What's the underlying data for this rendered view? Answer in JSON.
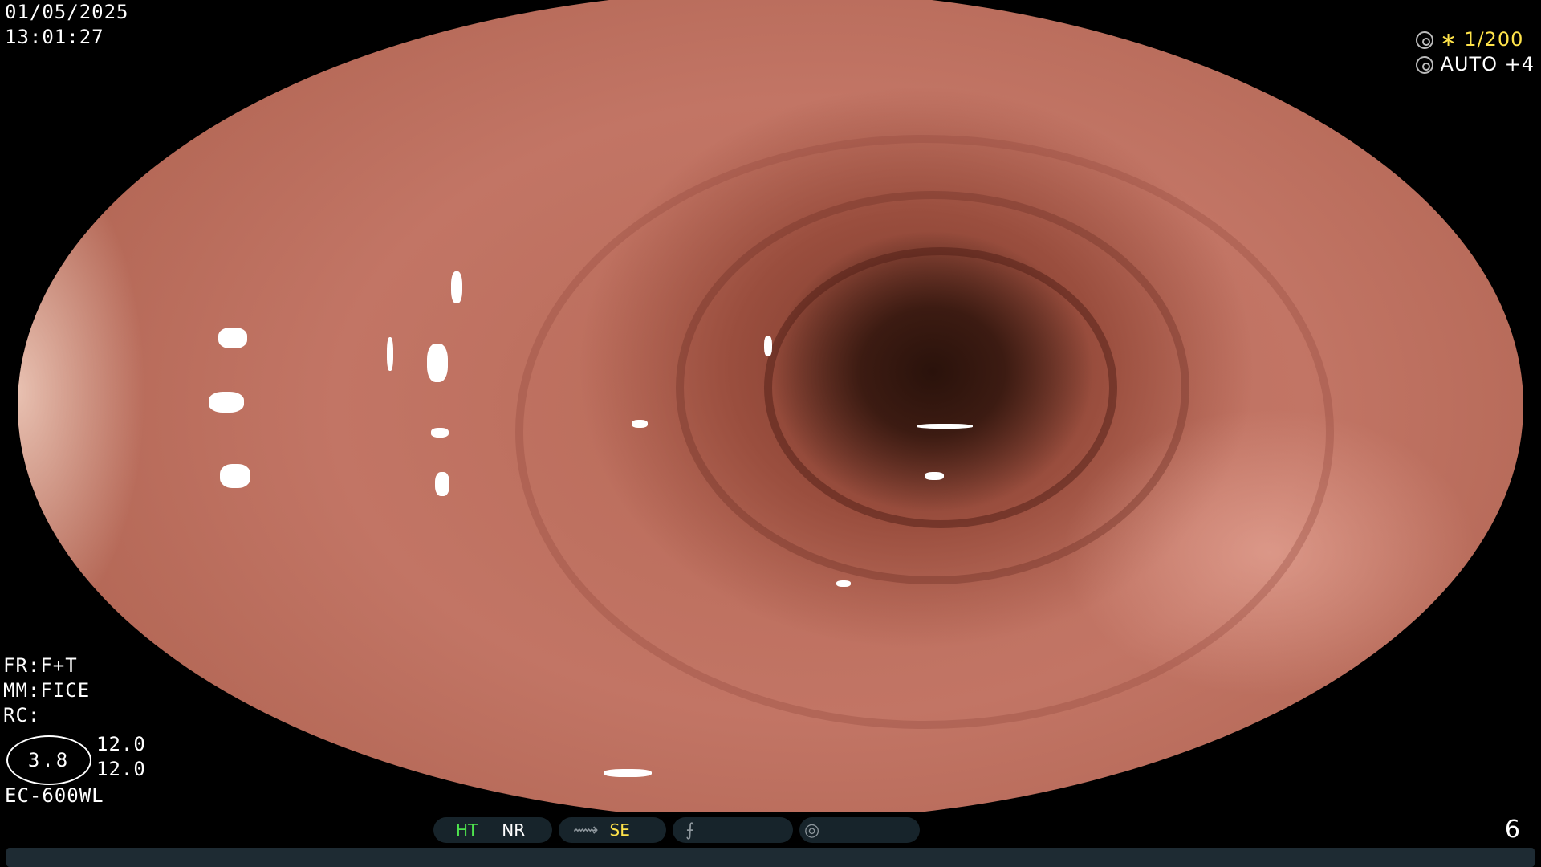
{
  "overlay": {
    "date": "01/05/2025",
    "time": "13:01:27",
    "shutter": "∗ 1/200",
    "iris": "AUTO +4",
    "fr": "FR:F+T",
    "mm": "MM:FICE",
    "rc": "RC:",
    "structure": "3.8",
    "value_1": "12.0",
    "value_2": "12.0",
    "scope_model": "EC-600WL"
  },
  "statusbar": {
    "ht": "HT",
    "nr": "NR",
    "se": "SE",
    "page": "6"
  },
  "icons": [
    "shutter-icon",
    "iris-icon",
    "freeze-icon",
    "function-icon",
    "waveform-icon"
  ],
  "colors": {
    "indicator_green": "#4ee44e",
    "indicator_yellow": "#ffe34a",
    "status_bar": "#17242b"
  }
}
